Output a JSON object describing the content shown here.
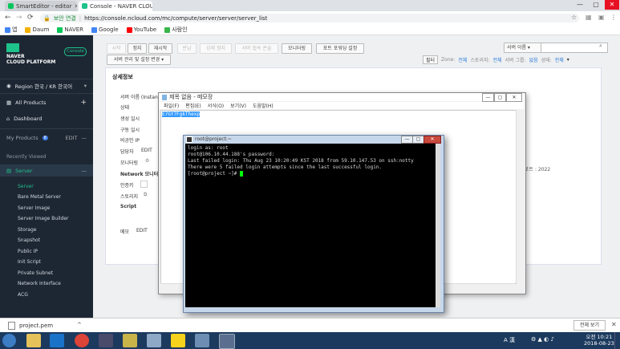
{
  "browser": {
    "tabs": [
      {
        "title": "SmartEditor - editor",
        "favicon_color": "#03c75a"
      },
      {
        "title": "Console - NAVER CLOU",
        "favicon_color": "#1ec28b"
      }
    ],
    "secure_label": "보안 연결",
    "url": "https://console.ncloud.com/mc/compute/server/server/server_list",
    "bookmarks": [
      {
        "label": "앱",
        "color": "#4285f4"
      },
      {
        "label": "Daum",
        "color": "#f2b200"
      },
      {
        "label": "NAVER",
        "color": "#03c75a"
      },
      {
        "label": "Google",
        "color": "#4285f4"
      },
      {
        "label": "YouTube",
        "color": "#ff0000"
      },
      {
        "label": "사람인",
        "color": "#39b54a"
      }
    ]
  },
  "sidebar": {
    "logo_line1": "NAVER",
    "logo_line2": "CLOUD PLATFORM",
    "console_badge": "Console",
    "region": "Region 한국 / KR 한국어",
    "all_products": "All Products",
    "dashboard": "Dashboard",
    "my_products": "My Products",
    "my_products_count": "8",
    "my_products_edit": "EDIT",
    "recently_viewed": "Recently Viewed",
    "server_section": "Server",
    "submenu": [
      "Server",
      "Bare Metal Server",
      "Server Image",
      "Server Image Builder",
      "Storage",
      "Snapshot",
      "Public IP",
      "Init Script",
      "Private Subnet",
      "Network Interface",
      "ACG"
    ]
  },
  "toolbar": {
    "buttons": [
      "시작",
      "정지",
      "재시작",
      "반납",
      "강제 정지",
      "서버 접속 콘솔",
      "모니터링",
      "포트 포워딩 설정"
    ],
    "manage_dropdown": "서버 관리 및 설정 변경",
    "server_name_select": "서버 이름",
    "filter_label": "필터",
    "filters": [
      "Zone:",
      "전체",
      "스토리지:",
      "전체",
      "서버 그룹:",
      "없음",
      "상태:",
      "전체"
    ]
  },
  "detail": {
    "title": "상세정보",
    "labels": [
      "서버 이름 (Instance ID)",
      "상태",
      "생성 일시",
      "구동 일시",
      "비공인 IP",
      "담당자",
      "모니터링",
      "Network 모니터링",
      "인증키",
      "스토리지",
      "Script"
    ],
    "edit_label": "EDIT",
    "memo_label": "메모",
    "memo_edit": "EDIT",
    "right_fragment": "포트 : 2022"
  },
  "notepad": {
    "title": "제목 없음 - 메모장",
    "menu": [
      "파일(F)",
      "편집(E)",
      "서식(O)",
      "보기(V)",
      "도움말(H)"
    ],
    "selected_text": "E7GY7FgkThexp"
  },
  "putty": {
    "title": "root@project:~",
    "lines": [
      "login as: root",
      "root@106.10.44.188's password:",
      "Last failed login: Thu Aug 23 10:20:49 KST 2018 from 59.10.147.53 on ssh:notty",
      "There were 5 failed login attempts since the last successful login.",
      "[root@project ~]# "
    ]
  },
  "download": {
    "file": "project.pem",
    "show_all": "전체 보기"
  },
  "taskbar": {
    "time": "오전 10:21",
    "date": "2018-08-23",
    "ime": "A 漢"
  }
}
